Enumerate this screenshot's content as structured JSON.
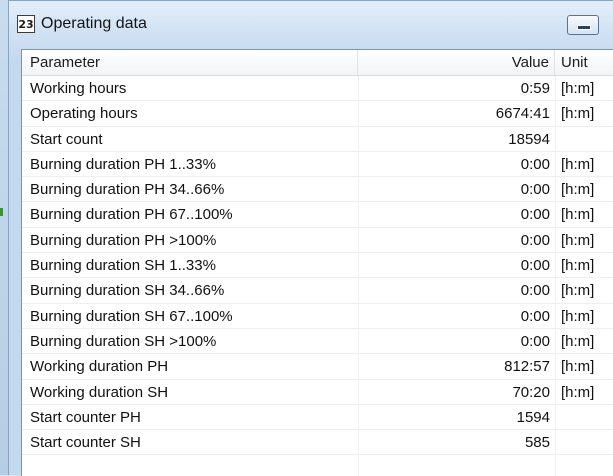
{
  "window": {
    "title": "Operating data",
    "icon_text": "23"
  },
  "table": {
    "columns": [
      "Parameter",
      "Value",
      "Unit"
    ],
    "rows": [
      {
        "parameter": "Working hours",
        "value": "0:59",
        "unit": "[h:m]"
      },
      {
        "parameter": "Operating hours",
        "value": "6674:41",
        "unit": "[h:m]"
      },
      {
        "parameter": "Start count",
        "value": "18594",
        "unit": ""
      },
      {
        "parameter": "Burning duration PH 1..33%",
        "value": "0:00",
        "unit": "[h:m]"
      },
      {
        "parameter": "Burning duration PH 34..66%",
        "value": "0:00",
        "unit": "[h:m]"
      },
      {
        "parameter": "Burning duration PH 67..100%",
        "value": "0:00",
        "unit": "[h:m]"
      },
      {
        "parameter": "Burning duration PH >100%",
        "value": "0:00",
        "unit": "[h:m]"
      },
      {
        "parameter": "Burning duration SH 1..33%",
        "value": "0:00",
        "unit": "[h:m]"
      },
      {
        "parameter": "Burning duration SH 34..66%",
        "value": "0:00",
        "unit": "[h:m]"
      },
      {
        "parameter": "Burning duration SH 67..100%",
        "value": "0:00",
        "unit": "[h:m]"
      },
      {
        "parameter": "Burning duration SH >100%",
        "value": "0:00",
        "unit": "[h:m]"
      },
      {
        "parameter": "Working duration PH",
        "value": "812:57",
        "unit": "[h:m]"
      },
      {
        "parameter": "Working duration SH",
        "value": "70:20",
        "unit": "[h:m]"
      },
      {
        "parameter": "Start counter PH",
        "value": "1594",
        "unit": ""
      },
      {
        "parameter": "Start counter SH",
        "value": "585",
        "unit": ""
      }
    ]
  }
}
